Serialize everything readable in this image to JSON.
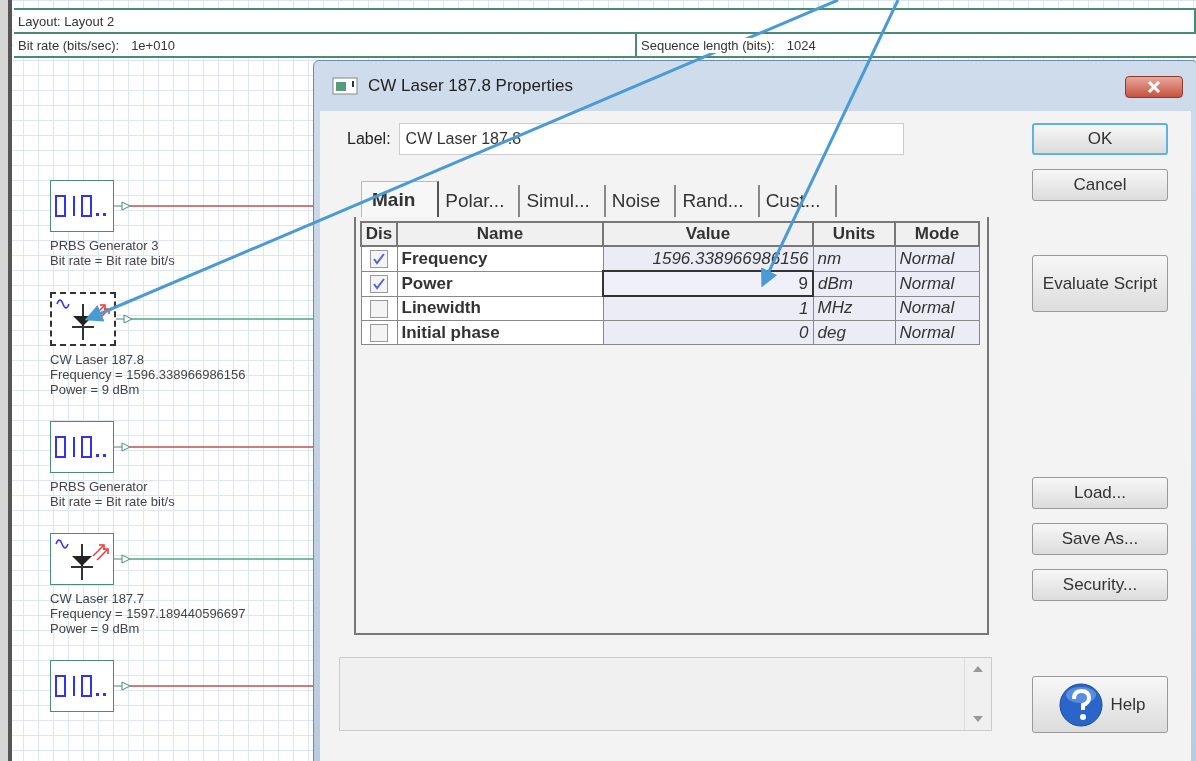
{
  "layout_bar": {
    "title": "Layout: Layout 2",
    "params": [
      {
        "label": "Bit rate (bits/sec):",
        "value": "1e+010"
      },
      {
        "label": "Sequence length (bits):",
        "value": "1024"
      }
    ]
  },
  "canvas": {
    "components": [
      {
        "kind": "prbs",
        "selected": false,
        "lines": [
          "PRBS Generator 3",
          "Bit rate = Bit rate  bit/s"
        ]
      },
      {
        "kind": "laser",
        "selected": true,
        "lines": [
          "CW Laser 187.8",
          "Frequency = 1596.338966986156",
          "Power = 9  dBm"
        ]
      },
      {
        "kind": "prbs",
        "selected": false,
        "lines": [
          "PRBS Generator",
          "Bit rate = Bit rate  bit/s"
        ]
      },
      {
        "kind": "laser",
        "selected": false,
        "lines": [
          "CW Laser 187.7",
          "Frequency = 1597.189440596697",
          "Power = 9  dBm"
        ]
      },
      {
        "kind": "prbs",
        "selected": false
      }
    ]
  },
  "dialog": {
    "title": "CW Laser 187.8 Properties",
    "label_caption": "Label:",
    "label_value": "CW Laser 187.8",
    "tabs": [
      {
        "label": "Main",
        "selected": true
      },
      {
        "label": "Polar...",
        "selected": false
      },
      {
        "label": "Simul...",
        "selected": false
      },
      {
        "label": "Noise",
        "selected": false
      },
      {
        "label": "Rand...",
        "selected": false
      },
      {
        "label": "Cust...",
        "selected": false
      }
    ],
    "table": {
      "columns": [
        "Dis",
        "Name",
        "Value",
        "Units",
        "Mode"
      ],
      "rows": [
        {
          "checked": true,
          "selected": false,
          "name": "Frequency",
          "value": "1596.338966986156",
          "units": "nm",
          "mode": "Normal"
        },
        {
          "checked": true,
          "selected": true,
          "name": "Power",
          "value": "9",
          "units": "dBm",
          "mode": "Normal"
        },
        {
          "checked": false,
          "selected": false,
          "name": "Linewidth",
          "value": "1",
          "units": "MHz",
          "mode": "Normal"
        },
        {
          "checked": false,
          "selected": false,
          "name": "Initial phase",
          "value": "0",
          "units": "deg",
          "mode": "Normal"
        }
      ]
    },
    "buttons": [
      {
        "label": "OK",
        "kind": "default"
      },
      {
        "label": "Cancel",
        "kind": "normal"
      },
      {
        "label": "Evaluate Script",
        "kind": "tall"
      },
      {
        "label": "Load...",
        "kind": "gap"
      },
      {
        "label": "Save As...",
        "kind": "normal"
      },
      {
        "label": "Security...",
        "kind": "normal"
      },
      {
        "label": "Help",
        "kind": "help"
      }
    ]
  }
}
